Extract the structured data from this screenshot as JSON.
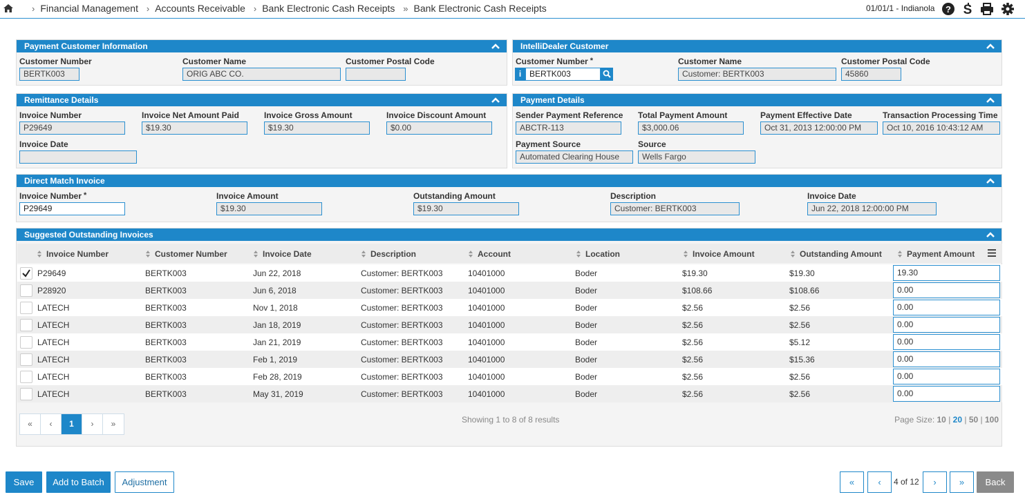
{
  "breadcrumb": [
    "Financial Management",
    "Accounts Receivable",
    "Bank Electronic Cash Receipts",
    "Bank Electronic Cash Receipts"
  ],
  "location": "01/01/1 - Indianola",
  "payment_customer": {
    "title": "Payment Customer Information",
    "cust_num_label": "Customer Number",
    "cust_num": "BERTK003",
    "cust_name_label": "Customer Name",
    "cust_name": "ORIG ABC CO.",
    "postal_label": "Customer Postal Code",
    "postal": ""
  },
  "intellidealer": {
    "title": "IntelliDealer Customer",
    "cust_num_label": "Customer Number",
    "req": "*",
    "cust_num": "BERTK003",
    "info_glyph": "i",
    "cust_name_label": "Customer Name",
    "cust_name": "Customer: BERTK003",
    "postal_label": "Customer Postal Code",
    "postal": "45860"
  },
  "remittance": {
    "title": "Remittance Details",
    "inv_num_label": "Invoice Number",
    "inv_num": "P29649",
    "net_label": "Invoice Net Amount Paid",
    "net": "$19.30",
    "gross_label": "Invoice Gross Amount",
    "gross": "$19.30",
    "disc_label": "Invoice Discount Amount",
    "disc": "$0.00",
    "date_label": "Invoice Date",
    "date": ""
  },
  "payment_details": {
    "title": "Payment Details",
    "ref_label": "Sender Payment Reference",
    "ref": "ABCTR-113",
    "total_label": "Total Payment Amount",
    "total": "$3,000.06",
    "eff_label": "Payment Effective Date",
    "eff": "Oct 31, 2013 12:00:00 PM",
    "proc_label": "Transaction Processing Time",
    "proc": "Oct 10, 2016 10:43:12 AM",
    "src_label": "Payment Source",
    "src": "Automated Clearing House",
    "source_label": "Source",
    "source": "Wells Fargo"
  },
  "direct_match": {
    "title": "Direct Match Invoice",
    "inv_num_label": "Invoice Number",
    "req": "*",
    "inv_num": "P29649",
    "amt_label": "Invoice Amount",
    "amt": "$19.30",
    "out_label": "Outstanding Amount",
    "out": "$19.30",
    "desc_label": "Description",
    "desc": "Customer: BERTK003",
    "date_label": "Invoice Date",
    "date": "Jun 22, 2018 12:00:00 PM"
  },
  "suggested": {
    "title": "Suggested Outstanding Invoices",
    "headers": [
      "Invoice Number",
      "Customer Number",
      "Invoice Date",
      "Description",
      "Account",
      "Location",
      "Invoice Amount",
      "Outstanding Amount",
      "Payment Amount"
    ],
    "rows": [
      {
        "checked": true,
        "inv": "P29649",
        "cust": "BERTK003",
        "date": "Jun 22, 2018",
        "desc": "Customer: BERTK003",
        "acct": "10401000",
        "loc": "Boder",
        "amt": "$19.30",
        "out": "$19.30",
        "pay": "19.30"
      },
      {
        "checked": false,
        "inv": "P28920",
        "cust": "BERTK003",
        "date": "Jun 6, 2018",
        "desc": "Customer: BERTK003",
        "acct": "10401000",
        "loc": "Boder",
        "amt": "$108.66",
        "out": "$108.66",
        "pay": "0.00"
      },
      {
        "checked": false,
        "inv": "LATECH",
        "cust": "BERTK003",
        "date": "Nov 1, 2018",
        "desc": "Customer: BERTK003",
        "acct": "10401000",
        "loc": "Boder",
        "amt": "$2.56",
        "out": "$2.56",
        "pay": "0.00"
      },
      {
        "checked": false,
        "inv": "LATECH",
        "cust": "BERTK003",
        "date": "Jan 18, 2019",
        "desc": "Customer: BERTK003",
        "acct": "10401000",
        "loc": "Boder",
        "amt": "$2.56",
        "out": "$2.56",
        "pay": "0.00"
      },
      {
        "checked": false,
        "inv": "LATECH",
        "cust": "BERTK003",
        "date": "Jan 21, 2019",
        "desc": "Customer: BERTK003",
        "acct": "10401000",
        "loc": "Boder",
        "amt": "$2.56",
        "out": "$5.12",
        "pay": "0.00"
      },
      {
        "checked": false,
        "inv": "LATECH",
        "cust": "BERTK003",
        "date": "Feb 1, 2019",
        "desc": "Customer: BERTK003",
        "acct": "10401000",
        "loc": "Boder",
        "amt": "$2.56",
        "out": "$15.36",
        "pay": "0.00"
      },
      {
        "checked": false,
        "inv": "LATECH",
        "cust": "BERTK003",
        "date": "Feb 28, 2019",
        "desc": "Customer: BERTK003",
        "acct": "10401000",
        "loc": "Boder",
        "amt": "$2.56",
        "out": "$2.56",
        "pay": "0.00"
      },
      {
        "checked": false,
        "inv": "LATECH",
        "cust": "BERTK003",
        "date": "May 31, 2019",
        "desc": "Customer: BERTK003",
        "acct": "10401000",
        "loc": "Boder",
        "amt": "$2.56",
        "out": "$2.56",
        "pay": "0.00"
      }
    ],
    "pager": [
      "«",
      "‹",
      "1",
      "›",
      "»"
    ],
    "showing": "Showing 1 to 8 of 8 results",
    "page_size_label": "Page Size:",
    "page_sizes": [
      "10",
      "20",
      "50",
      "100"
    ]
  },
  "footer": {
    "save": "Save",
    "add_batch": "Add to Batch",
    "adjustment": "Adjustment",
    "record_pos": "4 of 12",
    "first": "«",
    "prev": "‹",
    "next": "›",
    "last": "»",
    "back": "Back"
  },
  "colors": {
    "accent": "#1e87c9",
    "panel": "#f4f4f4",
    "back_btn": "#8a8a8a"
  }
}
